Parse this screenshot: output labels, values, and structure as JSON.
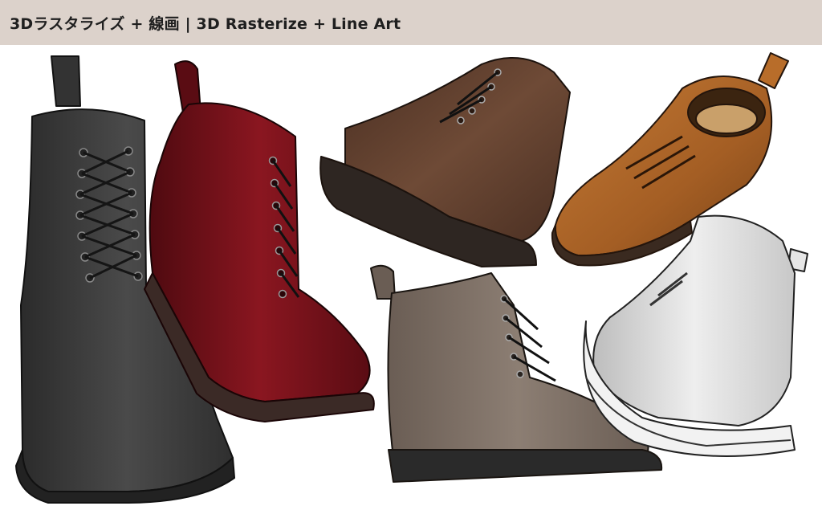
{
  "header": {
    "title": "3Dラスタライズ + 線画 | 3D Rasterize + Line Art"
  },
  "boots": [
    {
      "name": "black-boot",
      "color": "#3a3a3a",
      "sole": "#2a2a2a"
    },
    {
      "name": "red-boot",
      "color": "#6e0f17",
      "sole": "#3b2a26"
    },
    {
      "name": "dark-brown-boot",
      "color": "#5a3a2a",
      "sole": "#2e2622"
    },
    {
      "name": "tan-boot",
      "color": "#a8632a",
      "sole": "#3a2a20"
    },
    {
      "name": "taupe-boot",
      "color": "#7a6c62",
      "sole": "#2a2a2a"
    },
    {
      "name": "white-boot",
      "color": "#d8d8d8",
      "sole": "#f2f2f2"
    }
  ]
}
